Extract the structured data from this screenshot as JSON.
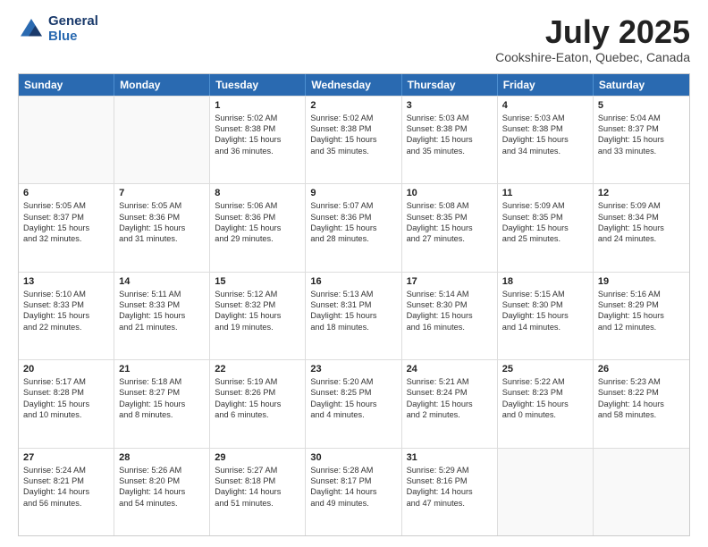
{
  "header": {
    "logo_line1": "General",
    "logo_line2": "Blue",
    "month_year": "July 2025",
    "location": "Cookshire-Eaton, Quebec, Canada"
  },
  "weekdays": [
    "Sunday",
    "Monday",
    "Tuesday",
    "Wednesday",
    "Thursday",
    "Friday",
    "Saturday"
  ],
  "rows": [
    [
      {
        "day": "",
        "lines": []
      },
      {
        "day": "",
        "lines": []
      },
      {
        "day": "1",
        "lines": [
          "Sunrise: 5:02 AM",
          "Sunset: 8:38 PM",
          "Daylight: 15 hours",
          "and 36 minutes."
        ]
      },
      {
        "day": "2",
        "lines": [
          "Sunrise: 5:02 AM",
          "Sunset: 8:38 PM",
          "Daylight: 15 hours",
          "and 35 minutes."
        ]
      },
      {
        "day": "3",
        "lines": [
          "Sunrise: 5:03 AM",
          "Sunset: 8:38 PM",
          "Daylight: 15 hours",
          "and 35 minutes."
        ]
      },
      {
        "day": "4",
        "lines": [
          "Sunrise: 5:03 AM",
          "Sunset: 8:38 PM",
          "Daylight: 15 hours",
          "and 34 minutes."
        ]
      },
      {
        "day": "5",
        "lines": [
          "Sunrise: 5:04 AM",
          "Sunset: 8:37 PM",
          "Daylight: 15 hours",
          "and 33 minutes."
        ]
      }
    ],
    [
      {
        "day": "6",
        "lines": [
          "Sunrise: 5:05 AM",
          "Sunset: 8:37 PM",
          "Daylight: 15 hours",
          "and 32 minutes."
        ]
      },
      {
        "day": "7",
        "lines": [
          "Sunrise: 5:05 AM",
          "Sunset: 8:36 PM",
          "Daylight: 15 hours",
          "and 31 minutes."
        ]
      },
      {
        "day": "8",
        "lines": [
          "Sunrise: 5:06 AM",
          "Sunset: 8:36 PM",
          "Daylight: 15 hours",
          "and 29 minutes."
        ]
      },
      {
        "day": "9",
        "lines": [
          "Sunrise: 5:07 AM",
          "Sunset: 8:36 PM",
          "Daylight: 15 hours",
          "and 28 minutes."
        ]
      },
      {
        "day": "10",
        "lines": [
          "Sunrise: 5:08 AM",
          "Sunset: 8:35 PM",
          "Daylight: 15 hours",
          "and 27 minutes."
        ]
      },
      {
        "day": "11",
        "lines": [
          "Sunrise: 5:09 AM",
          "Sunset: 8:35 PM",
          "Daylight: 15 hours",
          "and 25 minutes."
        ]
      },
      {
        "day": "12",
        "lines": [
          "Sunrise: 5:09 AM",
          "Sunset: 8:34 PM",
          "Daylight: 15 hours",
          "and 24 minutes."
        ]
      }
    ],
    [
      {
        "day": "13",
        "lines": [
          "Sunrise: 5:10 AM",
          "Sunset: 8:33 PM",
          "Daylight: 15 hours",
          "and 22 minutes."
        ]
      },
      {
        "day": "14",
        "lines": [
          "Sunrise: 5:11 AM",
          "Sunset: 8:33 PM",
          "Daylight: 15 hours",
          "and 21 minutes."
        ]
      },
      {
        "day": "15",
        "lines": [
          "Sunrise: 5:12 AM",
          "Sunset: 8:32 PM",
          "Daylight: 15 hours",
          "and 19 minutes."
        ]
      },
      {
        "day": "16",
        "lines": [
          "Sunrise: 5:13 AM",
          "Sunset: 8:31 PM",
          "Daylight: 15 hours",
          "and 18 minutes."
        ]
      },
      {
        "day": "17",
        "lines": [
          "Sunrise: 5:14 AM",
          "Sunset: 8:30 PM",
          "Daylight: 15 hours",
          "and 16 minutes."
        ]
      },
      {
        "day": "18",
        "lines": [
          "Sunrise: 5:15 AM",
          "Sunset: 8:30 PM",
          "Daylight: 15 hours",
          "and 14 minutes."
        ]
      },
      {
        "day": "19",
        "lines": [
          "Sunrise: 5:16 AM",
          "Sunset: 8:29 PM",
          "Daylight: 15 hours",
          "and 12 minutes."
        ]
      }
    ],
    [
      {
        "day": "20",
        "lines": [
          "Sunrise: 5:17 AM",
          "Sunset: 8:28 PM",
          "Daylight: 15 hours",
          "and 10 minutes."
        ]
      },
      {
        "day": "21",
        "lines": [
          "Sunrise: 5:18 AM",
          "Sunset: 8:27 PM",
          "Daylight: 15 hours",
          "and 8 minutes."
        ]
      },
      {
        "day": "22",
        "lines": [
          "Sunrise: 5:19 AM",
          "Sunset: 8:26 PM",
          "Daylight: 15 hours",
          "and 6 minutes."
        ]
      },
      {
        "day": "23",
        "lines": [
          "Sunrise: 5:20 AM",
          "Sunset: 8:25 PM",
          "Daylight: 15 hours",
          "and 4 minutes."
        ]
      },
      {
        "day": "24",
        "lines": [
          "Sunrise: 5:21 AM",
          "Sunset: 8:24 PM",
          "Daylight: 15 hours",
          "and 2 minutes."
        ]
      },
      {
        "day": "25",
        "lines": [
          "Sunrise: 5:22 AM",
          "Sunset: 8:23 PM",
          "Daylight: 15 hours",
          "and 0 minutes."
        ]
      },
      {
        "day": "26",
        "lines": [
          "Sunrise: 5:23 AM",
          "Sunset: 8:22 PM",
          "Daylight: 14 hours",
          "and 58 minutes."
        ]
      }
    ],
    [
      {
        "day": "27",
        "lines": [
          "Sunrise: 5:24 AM",
          "Sunset: 8:21 PM",
          "Daylight: 14 hours",
          "and 56 minutes."
        ]
      },
      {
        "day": "28",
        "lines": [
          "Sunrise: 5:26 AM",
          "Sunset: 8:20 PM",
          "Daylight: 14 hours",
          "and 54 minutes."
        ]
      },
      {
        "day": "29",
        "lines": [
          "Sunrise: 5:27 AM",
          "Sunset: 8:18 PM",
          "Daylight: 14 hours",
          "and 51 minutes."
        ]
      },
      {
        "day": "30",
        "lines": [
          "Sunrise: 5:28 AM",
          "Sunset: 8:17 PM",
          "Daylight: 14 hours",
          "and 49 minutes."
        ]
      },
      {
        "day": "31",
        "lines": [
          "Sunrise: 5:29 AM",
          "Sunset: 8:16 PM",
          "Daylight: 14 hours",
          "and 47 minutes."
        ]
      },
      {
        "day": "",
        "lines": []
      },
      {
        "day": "",
        "lines": []
      }
    ]
  ]
}
